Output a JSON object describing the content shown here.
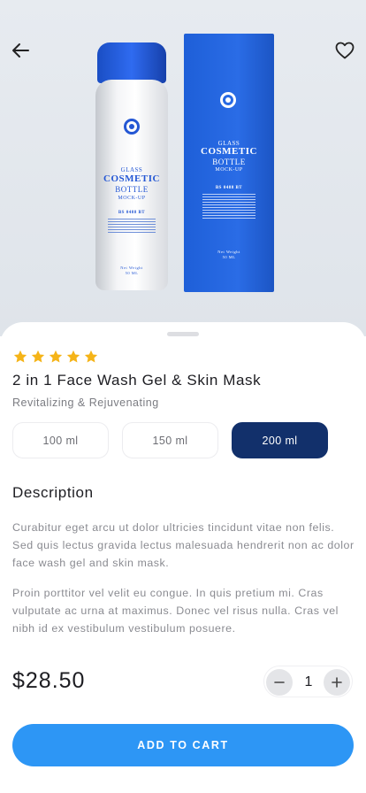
{
  "hero": {
    "background": "#e3e7ec",
    "back_icon": "arrow-left-icon",
    "favorite_icon": "heart-outline-icon",
    "product_image": {
      "bottle_label": {
        "line1": "GLASS",
        "line2": "COSMETIC",
        "line3": "BOTTLE",
        "line4": "MOCK-UP",
        "code": "BS 0488 BT",
        "weight": "Net Weight",
        "volume": "50 ML"
      },
      "box_label": {
        "line1": "GLASS",
        "line2": "COSMETIC",
        "line3": "BOTTLE",
        "line4": "MOCK-UP",
        "code": "BS 0488 BT",
        "weight": "Net Weight",
        "volume": "50 ML"
      }
    }
  },
  "product": {
    "rating": 5,
    "star_color": "#f5b418",
    "title": "2 in 1 Face Wash Gel & Skin Mask",
    "subtitle": "Revitalizing & Rejuvenating",
    "sizes": [
      {
        "label": "100 ml",
        "selected": false
      },
      {
        "label": "150 ml",
        "selected": false
      },
      {
        "label": "200 ml",
        "selected": true
      }
    ],
    "description_heading": "Description",
    "description": [
      "Curabitur eget arcu ut dolor ultricies tincidunt vitae non felis. Sed quis lectus gravida lectus malesuada hendrerit non ac dolor face wash gel and skin mask.",
      "Proin porttitor vel velit eu congue. In quis pretium mi. Cras vulputate ac urna at maximus. Donec vel risus nulla. Cras vel nibh id ex vestibulum vestibulum posuere."
    ],
    "price": "$28.50",
    "quantity": "1",
    "add_to_cart": "ADD TO CART"
  },
  "colors": {
    "accent": "#2d96f5",
    "selected_size": "#12306b",
    "brand_blue": "#2457d4"
  }
}
